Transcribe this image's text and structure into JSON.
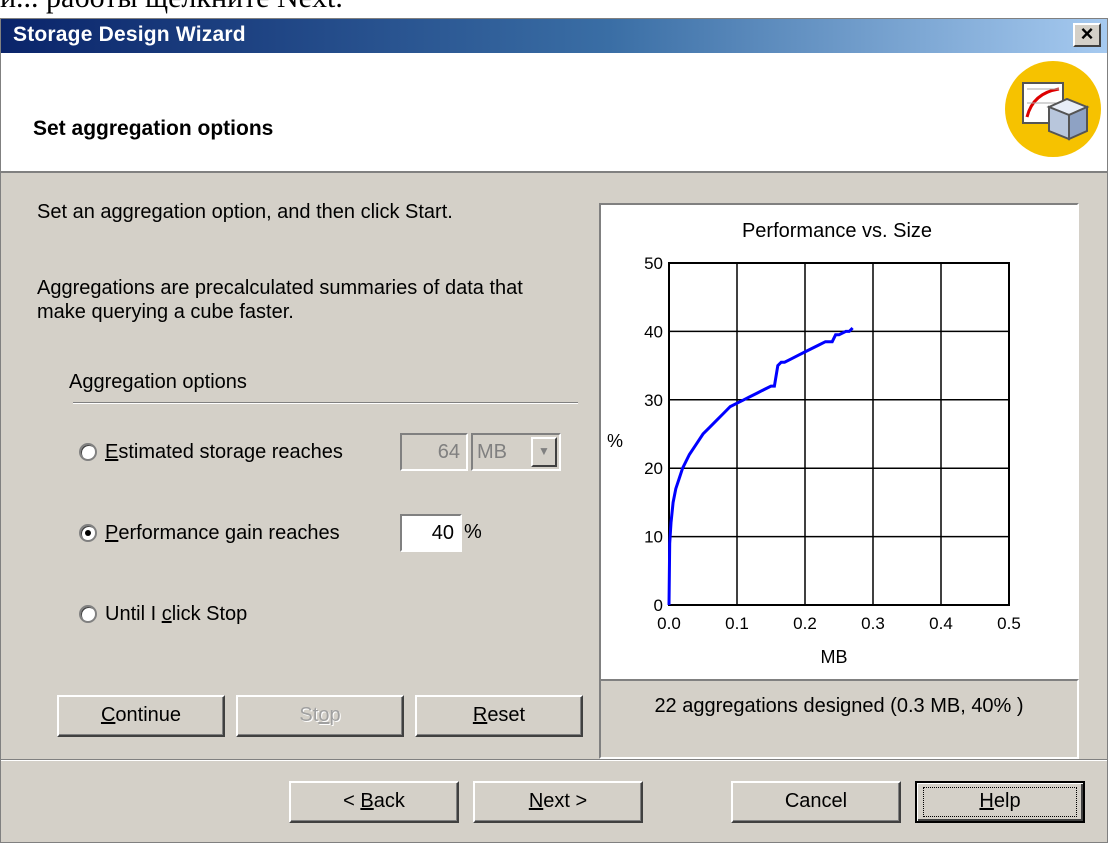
{
  "doc_fragment": "и... работы щелкните Next.",
  "window": {
    "title": "Storage Design Wizard",
    "close_label": "×"
  },
  "header": {
    "title": "Set aggregation options",
    "icon": "storage-design-wizard-icon"
  },
  "intro": {
    "line1": "Set an aggregation option, and then click Start.",
    "line2": "Aggregations are precalculated summaries of data that",
    "line3": "make querying a cube faster."
  },
  "options": {
    "group_label": "Aggregation options",
    "items": [
      {
        "label_accel": "E",
        "label_rest": "stimated storage reaches",
        "checked": false
      },
      {
        "label_accel": "P",
        "label_rest": "erformance gain reaches",
        "checked": true
      },
      {
        "label_pre": "Until I ",
        "label_accel": "c",
        "label_rest": "lick Stop",
        "checked": false
      }
    ],
    "storage_value": "64",
    "storage_unit": "MB",
    "performance_value": "40",
    "performance_unit": "%"
  },
  "buttons": {
    "continue_accel": "C",
    "continue_rest": "ontinue",
    "stop_pre": "St",
    "stop_accel": "o",
    "stop_rest": "p",
    "reset_accel": "R",
    "reset_rest": "eset",
    "back_pre": "< ",
    "back_accel": "B",
    "back_rest": "ack",
    "next_accel": "N",
    "next_rest": "ext >",
    "cancel": "Cancel",
    "help_accel": "H",
    "help_rest": "elp"
  },
  "status": {
    "text": "22 aggregations designed (0.3 MB, 40% )"
  },
  "chart_data": {
    "type": "line",
    "title": "Performance vs. Size",
    "xlabel": "MB",
    "ylabel": "%",
    "xlim": [
      0,
      0.5
    ],
    "ylim": [
      0,
      50
    ],
    "xticks": [
      "0.0",
      "0.1",
      "0.2",
      "0.3",
      "0.4",
      "0.5"
    ],
    "yticks": [
      "0",
      "10",
      "20",
      "30",
      "40",
      "50"
    ],
    "grid": true,
    "line_color": "#0000ff",
    "series": [
      {
        "x": [
          0,
          0.001,
          0.003,
          0.006,
          0.01,
          0.015,
          0.02,
          0.03,
          0.04,
          0.05,
          0.06,
          0.07,
          0.08,
          0.09,
          0.1,
          0.11,
          0.12,
          0.13,
          0.14,
          0.15,
          0.155,
          0.16,
          0.165,
          0.17,
          0.18,
          0.19,
          0.2,
          0.21,
          0.22,
          0.23,
          0.24,
          0.245,
          0.25,
          0.26,
          0.265,
          0.27
        ],
        "y": [
          0,
          9,
          12,
          15,
          17,
          18.5,
          20,
          22,
          23.5,
          25,
          26,
          27,
          28,
          29,
          29.5,
          30,
          30.5,
          31,
          31.5,
          32,
          32,
          35,
          35.5,
          35.5,
          36,
          36.5,
          37,
          37.5,
          38,
          38.5,
          38.5,
          39.5,
          39.5,
          40,
          40,
          40.5
        ]
      }
    ]
  }
}
